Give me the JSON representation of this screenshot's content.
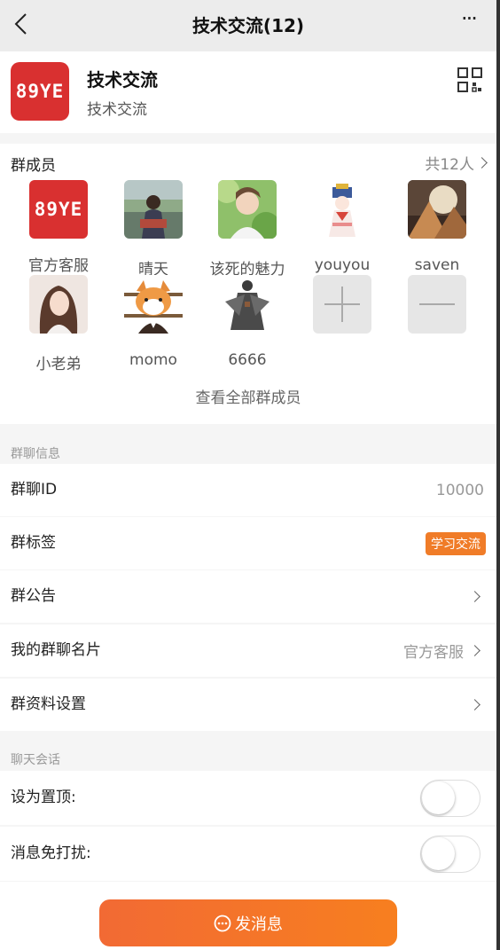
{
  "header": {
    "title": "技术交流(12)",
    "more_label": "···"
  },
  "group": {
    "logo_text": "89YE",
    "name": "技术交流",
    "description": "技术交流"
  },
  "members": {
    "title": "群成员",
    "count_label": "共12人",
    "list": [
      {
        "name": "官方客服",
        "icon": "logo"
      },
      {
        "name": "晴天",
        "icon": "photo-girl-landscape"
      },
      {
        "name": "该死的魅力",
        "icon": "photo-boy-green"
      },
      {
        "name": "youyou",
        "icon": "illustration-costume"
      },
      {
        "name": "saven",
        "icon": "photo-pyramid-moon"
      },
      {
        "name": "小老弟",
        "icon": "photo-girl-portrait"
      },
      {
        "name": "momo",
        "icon": "shiba-cartoon"
      },
      {
        "name": "6666",
        "icon": "warrior-figure"
      }
    ],
    "view_all": "查看全部群成员"
  },
  "group_info": {
    "label": "群聊信息",
    "rows": {
      "id": {
        "label": "群聊ID",
        "value": "10000"
      },
      "tag": {
        "label": "群标签",
        "value": "学习交流"
      },
      "notice": {
        "label": "群公告"
      },
      "card": {
        "label": "我的群聊名片",
        "value": "官方客服"
      },
      "settings": {
        "label": "群资料设置"
      }
    }
  },
  "chat": {
    "label": "聊天会话",
    "pin": {
      "label": "设为置顶:",
      "on": false
    },
    "mute": {
      "label": "消息免打扰:",
      "on": false
    }
  },
  "send_button": {
    "label": "发消息"
  },
  "colors": {
    "accent": "#f07c28",
    "logo": "#d93030",
    "button_start": "#f26a34",
    "button_end": "#f77f1f"
  }
}
